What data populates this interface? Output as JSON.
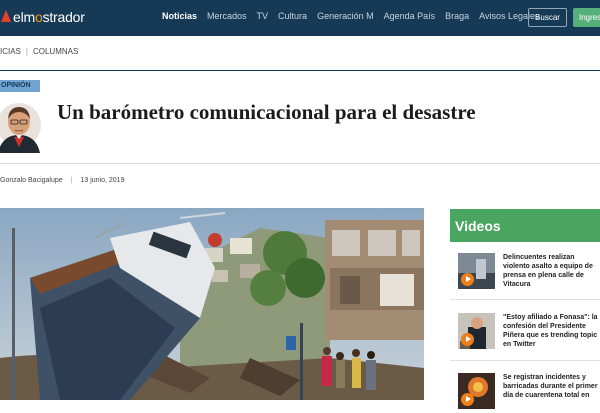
{
  "site": {
    "logo_prefix": "elm",
    "logo_o": "o",
    "logo_suffix": "strador"
  },
  "nav": {
    "items": [
      "Noticias",
      "Mercados",
      "TV",
      "Cultura",
      "Generación M",
      "Agenda País",
      "Braga",
      "Avisos Legales"
    ],
    "active": "Noticias",
    "search_label": "Buscar",
    "login_label": "Ingres"
  },
  "breadcrumb": {
    "items": [
      "ICIAS",
      "COLUMNAS"
    ]
  },
  "article": {
    "section_tag": "OPINIÓN",
    "title": "Un barómetro comunicacional para el desastre",
    "author": "Gonzalo Bacigalupe",
    "date": "13 junio, 2019"
  },
  "sidebar": {
    "heading": "Videos",
    "videos": [
      {
        "title": "Delincuentes realizan violento asalto a equipo de prensa en plena calle de Vitacura"
      },
      {
        "title": "\"Estoy afiliado a Fonasa\": la confesión del Presidente Piñera que es trending topic en Twitter"
      },
      {
        "title": "Se registran incidentes y barricadas durante el primer día de cuarentena total en"
      }
    ]
  },
  "colors": {
    "nav_bg": "#163a56",
    "accent_green": "#4aa561",
    "tag_blue": "#6fa4d3",
    "play_orange": "#f07e17"
  }
}
